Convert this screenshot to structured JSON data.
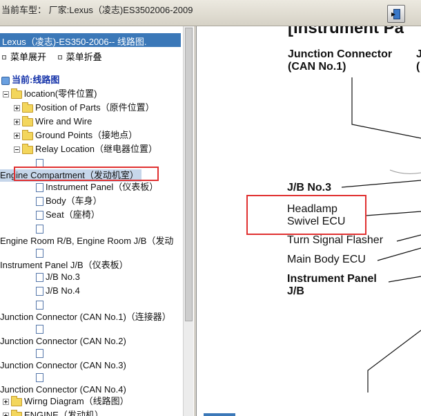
{
  "window": {
    "title": "当前车型：  厂家:Lexus（凌志)ES3502006-2009",
    "exit_icon": "exit-door-icon"
  },
  "tree": {
    "header": "Lexus（凌志)-ES350-2006-- 线路图.",
    "menu_expand": "菜单展开",
    "menu_collapse": "菜单折叠",
    "root_label": "当前:线路图",
    "nodes": [
      {
        "label": "location(零件位置)"
      },
      {
        "label": "Position of Parts（原件位置）"
      },
      {
        "label": "Wire and Wire"
      },
      {
        "label": "Ground Points（接地点）"
      },
      {
        "label": "Relay Location（继电器位置）"
      },
      {
        "label": "Engine Compartment（发动机室）"
      },
      {
        "label": "Instrument Panel（仪表板）"
      },
      {
        "label": "Body（车身）"
      },
      {
        "label": "Seat（座椅）"
      },
      {
        "label": "Engine Room R/B, Engine Room J/B（发动"
      },
      {
        "label": "Instrument Panel J/B（仪表板）"
      },
      {
        "label": "J/B No.3"
      },
      {
        "label": "J/B No.4"
      },
      {
        "label": "Junction Connector (CAN No.1)（连接器）"
      },
      {
        "label": "Junction Connector (CAN No.2)"
      },
      {
        "label": "Junction Connector (CAN No.3)"
      },
      {
        "label": "Junction Connector (CAN No.4)"
      },
      {
        "label": "Wirng Diagram（线路图）"
      },
      {
        "label": "ENGINE（发动机）"
      }
    ]
  },
  "diagram": {
    "heading": "[Instrument Pa",
    "jc_line1": "Junction Connector",
    "jc_line2": "(CAN No.1)",
    "jc_right": "J",
    "jc_right2": "(",
    "jb3": "J/B No.3",
    "headlamp_line1": "Headlamp",
    "headlamp_line2": "Swivel ECU",
    "turn_signal": "Turn Signal Flasher",
    "main_body": "Main Body ECU",
    "ip_line1": "Instrument Panel",
    "ip_line2": "J/B"
  },
  "colors": {
    "header_blue": "#3b78b8",
    "highlight_red": "#e03030",
    "selected_bg": "#c6d6ea"
  }
}
